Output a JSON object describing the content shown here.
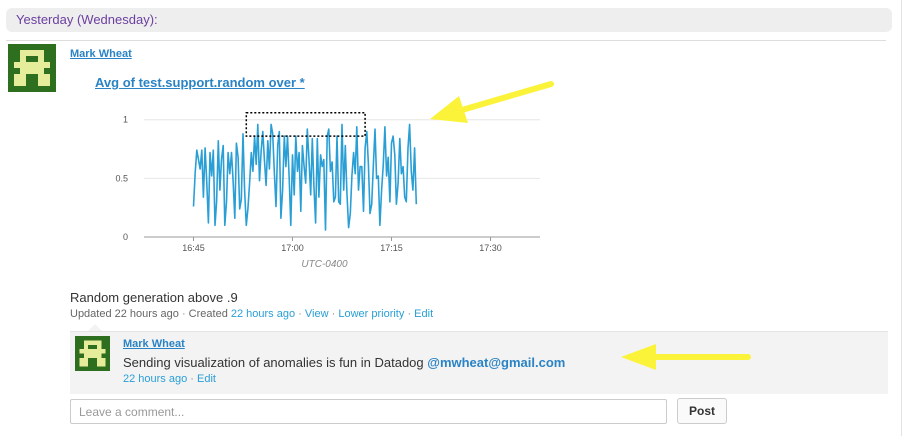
{
  "feed": {
    "day_header": "Yesterday (Wednesday):"
  },
  "event": {
    "author": "Mark Wheat",
    "graph_title": "Avg of test.support.random over *",
    "title": "Random generation above .9",
    "updated_text": "Updated 22 hours ago",
    "created_prefix": "Created",
    "created_link": "22 hours ago",
    "view_link": "View",
    "lower_priority_link": "Lower priority",
    "edit_link": "Edit"
  },
  "comment": {
    "author": "Mark Wheat",
    "text": "Sending visualization of anomalies is fun in Datadog",
    "mention": "@mwheat@gmail.com",
    "time_link": "22 hours ago",
    "edit_link": "Edit"
  },
  "new_comment": {
    "placeholder": "Leave a comment...",
    "post_label": "Post"
  },
  "colors": {
    "series": "#2a9fd6",
    "link": "#2a83c4",
    "avatar_bg": "#2d6e1f",
    "avatar_fg": "#e6ed9a",
    "annotation": "#fbf33a",
    "day_header_text": "#6b3fa0"
  },
  "icons": {
    "avatar": "pixel-avatar-icon",
    "arrow": "yellow-arrow-icon"
  },
  "chart_data": {
    "type": "line",
    "title": "Avg of test.support.random over *",
    "xlabel": "UTC-0400",
    "ylabel": "",
    "x_tick_labels": [
      "16:45",
      "17:00",
      "17:15",
      "17:30"
    ],
    "x_ticks_minutes": [
      0,
      15,
      30,
      45
    ],
    "xlim_minutes": [
      -7.5,
      52.5
    ],
    "y_tick_labels": [
      "0",
      "0.5",
      "1"
    ],
    "y_ticks": [
      0,
      0.5,
      1
    ],
    "ylim": [
      0,
      1.1
    ],
    "grid": true,
    "highlight_box": {
      "x0_minutes": 8,
      "x1_minutes": 26,
      "y0": 0.86,
      "y1": 1.06
    },
    "series": [
      {
        "name": "",
        "x_start_minute": 0,
        "x_step_minutes": 0.25,
        "values": [
          0.26,
          0.55,
          0.74,
          0.66,
          0.58,
          0.74,
          0.34,
          0.76,
          0.48,
          0.12,
          0.72,
          0.52,
          0.74,
          0.1,
          0.3,
          0.82,
          0.4,
          0.66,
          0.78,
          0.1,
          0.3,
          0.72,
          0.54,
          0.72,
          0.48,
          0.16,
          0.8,
          0.68,
          0.24,
          0.32,
          0.88,
          0.4,
          0.1,
          0.24,
          0.46,
          0.72,
          0.56,
          0.86,
          0.62,
          0.96,
          0.48,
          0.74,
          0.9,
          0.66,
          0.44,
          0.82,
          0.58,
          0.96,
          0.88,
          0.56,
          0.26,
          0.78,
          0.9,
          0.16,
          0.4,
          0.86,
          0.6,
          0.86,
          0.5,
          0.1,
          0.7,
          0.36,
          0.86,
          0.56,
          0.72,
          0.22,
          0.78,
          0.6,
          0.46,
          0.92,
          0.66,
          0.36,
          0.84,
          0.44,
          0.12,
          0.84,
          0.34,
          0.7,
          0.6,
          0.66,
          0.06,
          0.86,
          0.92,
          0.56,
          0.64,
          0.3,
          0.34,
          0.86,
          0.3,
          0.28,
          0.96,
          0.4,
          0.78,
          0.38,
          0.08,
          0.2,
          0.52,
          0.72,
          0.54,
          0.94,
          0.4,
          0.6,
          0.6,
          0.22,
          0.76,
          0.9,
          0.62,
          0.2,
          0.28,
          0.62,
          0.92,
          0.5,
          0.52,
          0.1,
          0.4,
          0.62,
          0.94,
          0.52,
          0.68,
          0.3,
          0.8,
          0.86,
          0.7,
          0.28,
          0.46,
          0.84,
          0.54,
          0.6,
          0.34,
          0.3,
          0.76,
          0.96,
          0.56,
          0.4,
          0.76,
          0.28
        ]
      }
    ]
  }
}
